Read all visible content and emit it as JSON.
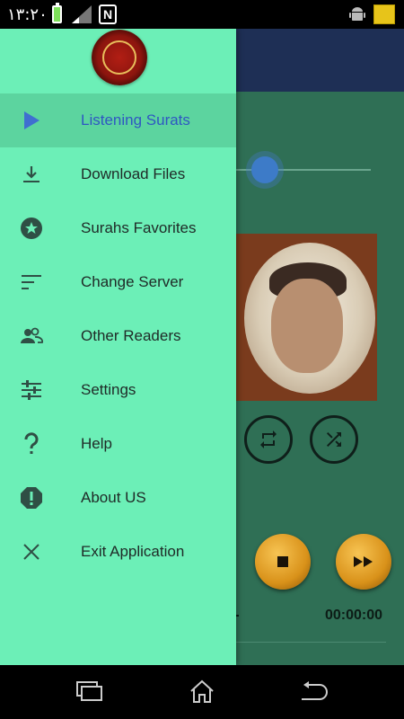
{
  "status_bar": {
    "time": "١٣:٢٠",
    "nfc_label": "N",
    "icons": [
      "battery-charging-icon",
      "signal-icon",
      "nfc-icon",
      "android-debug-icon",
      "app-notification-icon"
    ]
  },
  "player": {
    "elapsed": "00:00:00",
    "controls": [
      "repeat-icon",
      "shuffle-icon",
      "stop-icon",
      "fast-forward-icon"
    ]
  },
  "drawer": {
    "logo": "quran-logo-icon",
    "items": [
      {
        "label": "Listening Surats",
        "icon": "play-icon",
        "active": true
      },
      {
        "label": "Download Files",
        "icon": "download-icon",
        "active": false
      },
      {
        "label": "Surahs Favorites",
        "icon": "star-icon",
        "active": false
      },
      {
        "label": "Change Server",
        "icon": "sort-lines-icon",
        "active": false
      },
      {
        "label": "Other Readers",
        "icon": "people-icon",
        "active": false
      },
      {
        "label": "Settings",
        "icon": "sliders-icon",
        "active": false
      },
      {
        "label": "Help",
        "icon": "question-icon",
        "active": false
      },
      {
        "label": "About US",
        "icon": "info-alert-icon",
        "active": false
      },
      {
        "label": "Exit Application",
        "icon": "close-icon",
        "active": false
      }
    ]
  },
  "nav_bar": {
    "buttons": [
      "recent-apps-icon",
      "home-icon",
      "back-icon"
    ]
  },
  "colors": {
    "drawer_bg": "#6cefb7",
    "active_row": "#5cd49f",
    "active_text": "#2f57c2",
    "toolbar": "#1e2f55",
    "app_bg": "#2f6f55"
  }
}
